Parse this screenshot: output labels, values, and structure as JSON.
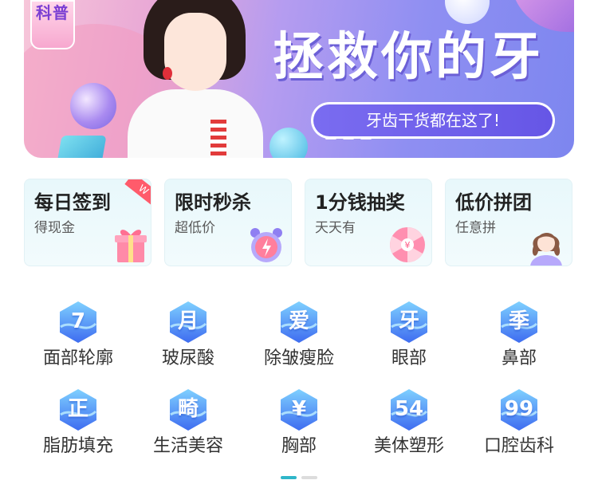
{
  "banner": {
    "badge_text": "科普",
    "title": "拯救你的牙",
    "subtitle": "牙齿干货都在这了!"
  },
  "promos": [
    {
      "title": "每日签到",
      "sub": "得现金",
      "tag": "W",
      "icon": "gift-icon"
    },
    {
      "title": "限时秒杀",
      "sub": "超低价",
      "icon": "alarm-clock-icon"
    },
    {
      "title": "1分钱抽奖",
      "sub": "天天有",
      "icon": "prize-wheel-icon"
    },
    {
      "title": "低价拼团",
      "sub": "任意拼",
      "icon": "person-icon"
    }
  ],
  "categories": [
    {
      "char": "7",
      "label": "面部轮廓"
    },
    {
      "char": "月",
      "label": "玻尿酸"
    },
    {
      "char": "爱",
      "label": "除皱瘦脸"
    },
    {
      "char": "牙",
      "label": "眼部"
    },
    {
      "char": "季",
      "label": "鼻部"
    },
    {
      "char": "正",
      "label": "脂肪填充"
    },
    {
      "char": "畸",
      "label": "生活美容"
    },
    {
      "char": "¥",
      "label": "胸部"
    },
    {
      "char": "54",
      "label": "美体塑形"
    },
    {
      "char": "99",
      "label": "口腔齿科"
    }
  ],
  "colors": {
    "accent": "#2fb6c9",
    "hex_icon": "#4a86f0",
    "promo_bg": "#e8f8fb",
    "banner_pill": "#6d5fea"
  }
}
